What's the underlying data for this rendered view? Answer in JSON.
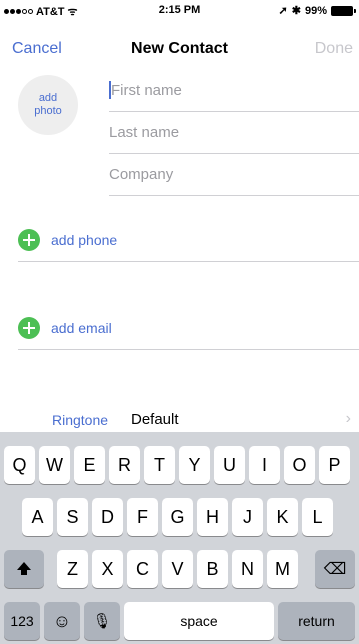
{
  "status_bar": {
    "carrier": "AT&T",
    "wifi_glyph": "ᯤ",
    "time": "2:15 PM",
    "location_glyph": "➚",
    "bluetooth_glyph": "✱",
    "battery": "99%"
  },
  "nav": {
    "cancel_label": "Cancel",
    "title": "New Contact",
    "done_label": "Done"
  },
  "photo": {
    "label": "add\nphoto"
  },
  "fields": {
    "first_name_placeholder": "First name",
    "last_name_placeholder": "Last name",
    "company_placeholder": "Company"
  },
  "rows": {
    "add_phone": "add phone",
    "add_email": "add email",
    "ringtone_label": "Ringtone",
    "ringtone_value": "Default"
  },
  "keyboard": {
    "row1": [
      "Q",
      "W",
      "E",
      "R",
      "T",
      "Y",
      "U",
      "I",
      "O",
      "P"
    ],
    "row2": [
      "A",
      "S",
      "D",
      "F",
      "G",
      "H",
      "J",
      "K",
      "L"
    ],
    "row3": [
      "Z",
      "X",
      "C",
      "V",
      "B",
      "N",
      "M"
    ],
    "numbers_label": "123",
    "emoji_glyph": "☺",
    "mic_glyph": "🎙",
    "space_label": "space",
    "return_label": "return",
    "backspace_glyph": "⌫"
  },
  "colors": {
    "accent": "#4a6ed0",
    "add_green": "#4cbf54",
    "keyboard_bg": "#d1d4d9"
  }
}
